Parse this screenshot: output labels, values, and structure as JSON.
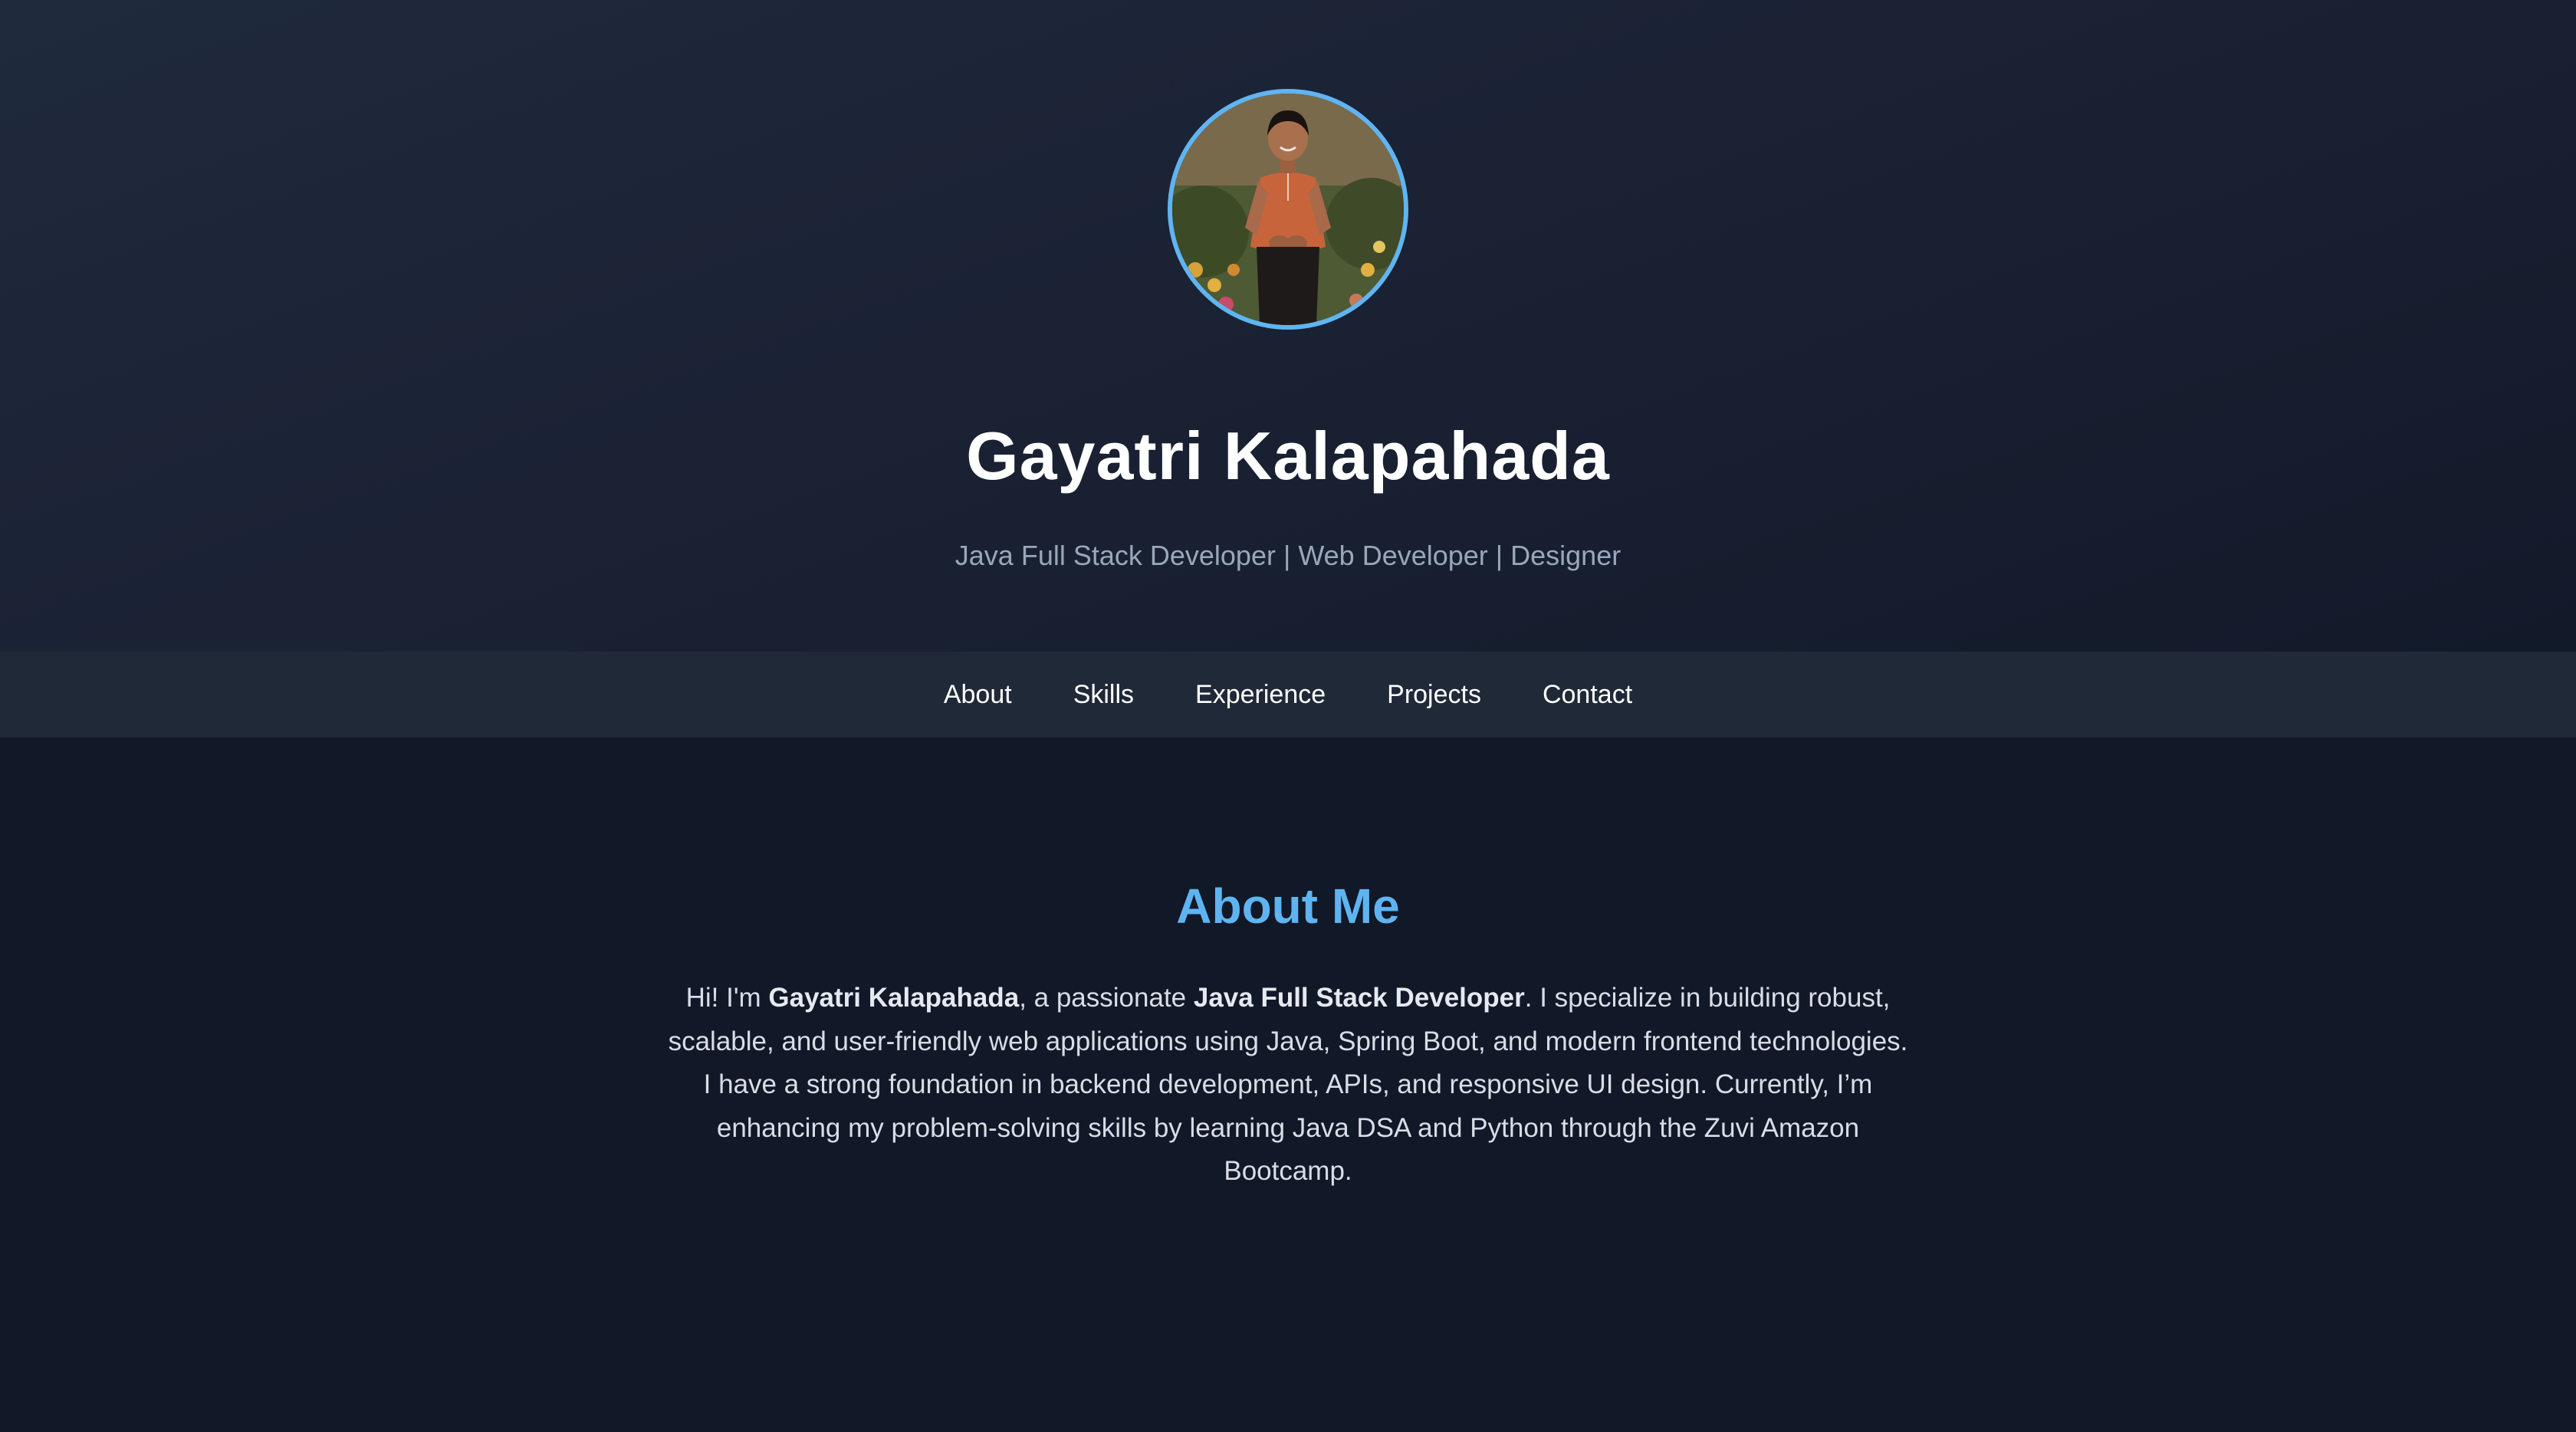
{
  "profile": {
    "name": "Gayatri Kalapahada",
    "tagline": "Java Full Stack Developer | Web Developer | Designer",
    "avatar_alt": "Profile photo"
  },
  "nav": {
    "items": [
      {
        "label": "About"
      },
      {
        "label": "Skills"
      },
      {
        "label": "Experience"
      },
      {
        "label": "Projects"
      },
      {
        "label": "Contact"
      }
    ]
  },
  "about": {
    "heading": "About Me",
    "text_1": "Hi! I'm ",
    "name_bold": "Gayatri Kalapahada",
    "text_2": ", a passionate ",
    "role_bold": "Java Full Stack Developer",
    "text_3": ". I specialize in building robust, scalable, and user-friendly web applications using Java, Spring Boot, and modern frontend technologies. I have a strong foundation in backend development, APIs, and responsive UI design. Currently, I’m enhancing my problem-solving skills by learning Java DSA and Python through the Zuvi Amazon Bootcamp."
  },
  "colors": {
    "accent": "#5eb4f1",
    "hero_bg": "#1a2234",
    "nav_bg": "#1f2937",
    "page_bg": "#111827"
  }
}
